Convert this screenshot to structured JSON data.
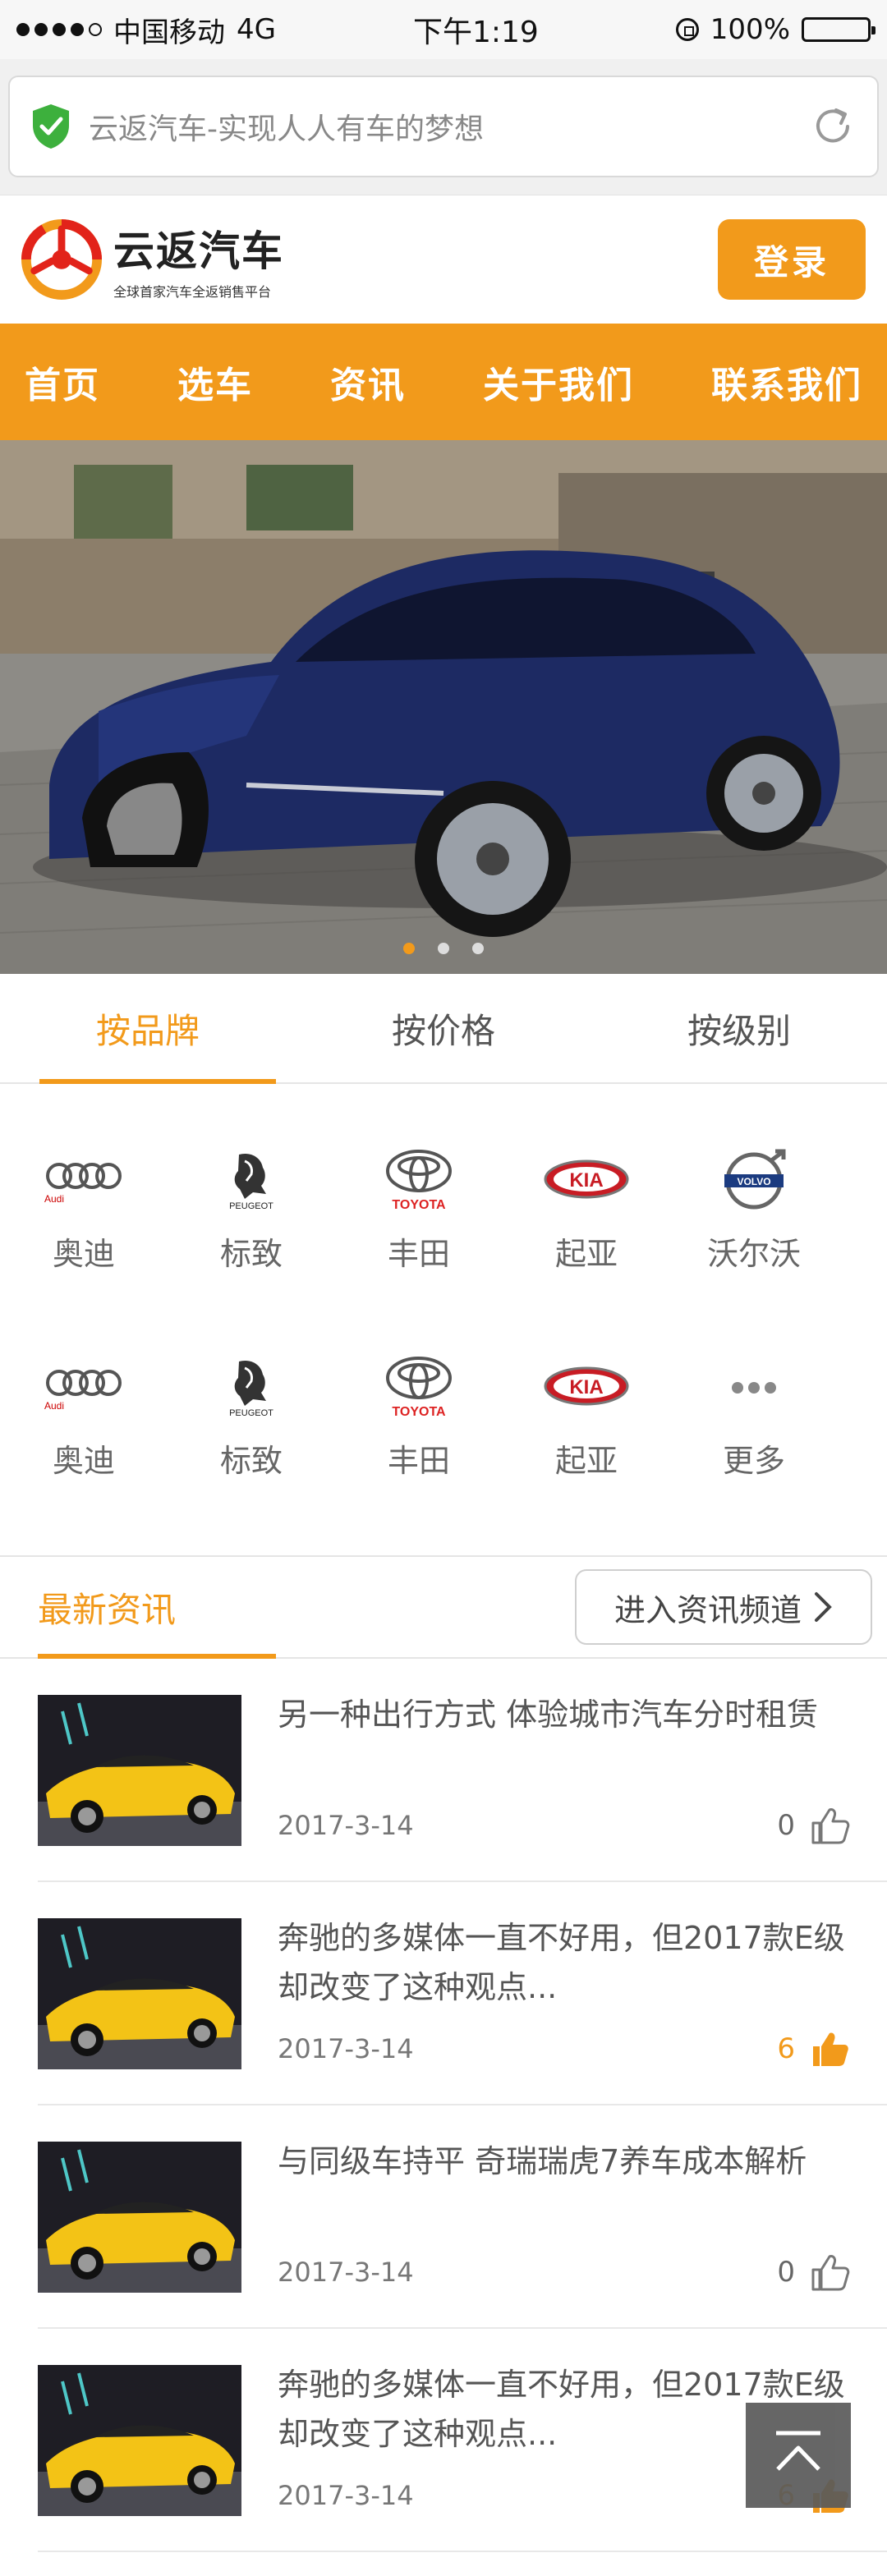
{
  "status_bar": {
    "carrier": "中国移动",
    "network": "4G",
    "time": "下午1:19",
    "battery": "100%"
  },
  "browser": {
    "url_title": "云返汽车-实现人人有车的梦想"
  },
  "header": {
    "brand": "云返汽车",
    "tagline": "全球首家汽车全返销售平台",
    "login_label": "登录"
  },
  "nav": {
    "items": [
      "首页",
      "选车",
      "资讯",
      "关于我们",
      "联系我们"
    ]
  },
  "banner": {
    "slide_count": 3,
    "active_slide": 1
  },
  "filter_tabs": {
    "items": [
      "按品牌",
      "按价格",
      "按级别"
    ],
    "active": 0
  },
  "brands": {
    "rows": [
      [
        {
          "name": "奥迪",
          "icon": "audi-logo-icon"
        },
        {
          "name": "标致",
          "icon": "peugeot-logo-icon"
        },
        {
          "name": "丰田",
          "icon": "toyota-logo-icon"
        },
        {
          "name": "起亚",
          "icon": "kia-logo-icon"
        },
        {
          "name": "沃尔沃",
          "icon": "volvo-logo-icon"
        }
      ],
      [
        {
          "name": "奥迪",
          "icon": "audi-logo-icon"
        },
        {
          "name": "标致",
          "icon": "peugeot-logo-icon"
        },
        {
          "name": "丰田",
          "icon": "toyota-logo-icon"
        },
        {
          "name": "起亚",
          "icon": "kia-logo-icon"
        },
        {
          "name": "更多",
          "icon": "more-dots-icon"
        }
      ]
    ],
    "logo_text": {
      "audi": "Audi",
      "peugeot": "PEUGEOT",
      "toyota": "TOYOTA",
      "kia": "KIA",
      "volvo": "VOLVO"
    }
  },
  "news": {
    "title": "最新资讯",
    "channel_link": "进入资讯频道",
    "items": [
      {
        "title": "另一种出行方式 体验城市汽车分时租赁",
        "date": "2017-3-14",
        "likes": "0",
        "liked": false
      },
      {
        "title": "奔驰的多媒体一直不好用，但2017款E级却改变了这种观点...",
        "date": "2017-3-14",
        "likes": "6",
        "liked": true
      },
      {
        "title": "与同级车持平 奇瑞瑞虎7养车成本解析",
        "date": "2017-3-14",
        "likes": "0",
        "liked": false
      },
      {
        "title": "奔驰的多媒体一直不好用，但2017款E级却改变了这种观点...",
        "date": "2017-3-14",
        "likes": "6",
        "liked": true
      }
    ]
  },
  "colors": {
    "accent": "#f29a1b",
    "text": "#555555"
  }
}
